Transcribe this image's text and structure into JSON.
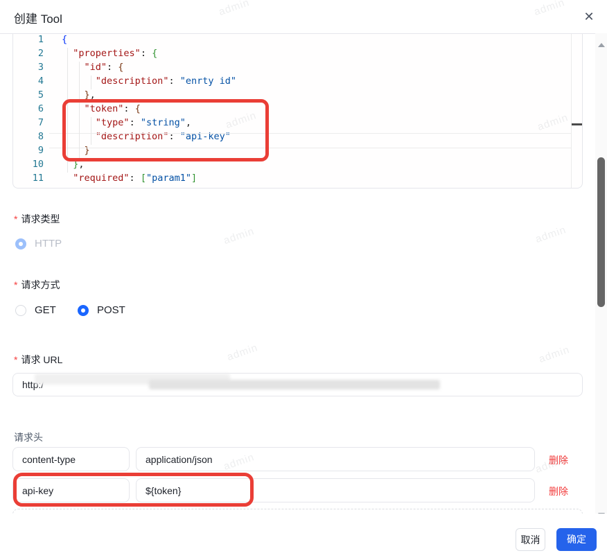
{
  "colors": {
    "accent_blue": "#1a66ff",
    "confirm_bg": "#2563eb",
    "danger_red": "#f23c3c",
    "annotation_red": "#ea3e36",
    "editor_key": "#a31515",
    "editor_string": "#0451a5",
    "line_number": "#237893"
  },
  "header": {
    "title": "创建 Tool",
    "close_icon": "✕"
  },
  "watermark": {
    "text": "admin"
  },
  "editor": {
    "lines": [
      {
        "num": "1",
        "tokens": [
          {
            "text": "{",
            "type": "b1"
          }
        ]
      },
      {
        "num": "2",
        "tokens": [
          {
            "text": "  ",
            "type": "pl"
          },
          {
            "text": "\"properties\"",
            "type": "key"
          },
          {
            "text": ": ",
            "type": "pl"
          },
          {
            "text": "{",
            "type": "b2"
          }
        ]
      },
      {
        "num": "3",
        "tokens": [
          {
            "text": "    ",
            "type": "pl"
          },
          {
            "text": "\"id\"",
            "type": "key"
          },
          {
            "text": ": ",
            "type": "pl"
          },
          {
            "text": "{",
            "type": "b3"
          }
        ]
      },
      {
        "num": "4",
        "tokens": [
          {
            "text": "      ",
            "type": "pl"
          },
          {
            "text": "\"description\"",
            "type": "key"
          },
          {
            "text": ": ",
            "type": "pl"
          },
          {
            "text": "\"enrty id\"",
            "type": "str"
          }
        ]
      },
      {
        "num": "5",
        "tokens": [
          {
            "text": "    ",
            "type": "pl"
          },
          {
            "text": "}",
            "type": "b3"
          },
          {
            "text": ",",
            "type": "pl"
          }
        ]
      },
      {
        "num": "6",
        "tokens": [
          {
            "text": "    ",
            "type": "pl"
          },
          {
            "text": "\"token\"",
            "type": "key"
          },
          {
            "text": ": ",
            "type": "pl"
          },
          {
            "text": "{",
            "type": "b3"
          }
        ]
      },
      {
        "num": "7",
        "tokens": [
          {
            "text": "      ",
            "type": "pl"
          },
          {
            "text": "\"type\"",
            "type": "key"
          },
          {
            "text": ": ",
            "type": "pl"
          },
          {
            "text": "\"string\"",
            "type": "str"
          },
          {
            "text": ",",
            "type": "pl"
          }
        ]
      },
      {
        "num": "8",
        "tokens": [
          {
            "text": "      ",
            "type": "pl"
          },
          {
            "text": "\"description\"",
            "type": "key"
          },
          {
            "text": ": ",
            "type": "pl"
          },
          {
            "text": "\"api-key\"",
            "type": "str"
          }
        ]
      },
      {
        "num": "9",
        "tokens": [
          {
            "text": "    ",
            "type": "pl"
          },
          {
            "text": "}",
            "type": "b3"
          }
        ]
      },
      {
        "num": "10",
        "tokens": [
          {
            "text": "  ",
            "type": "pl"
          },
          {
            "text": "}",
            "type": "b2"
          },
          {
            "text": ",",
            "type": "pl"
          }
        ]
      },
      {
        "num": "11",
        "tokens": [
          {
            "text": "  ",
            "type": "pl"
          },
          {
            "text": "\"required\"",
            "type": "key"
          },
          {
            "text": ": ",
            "type": "pl"
          },
          {
            "text": "[",
            "type": "b2"
          },
          {
            "text": "\"param1\"",
            "type": "str"
          },
          {
            "text": "]",
            "type": "b2"
          }
        ]
      }
    ]
  },
  "form": {
    "request_type": {
      "label": "请求类型",
      "asterisk": "*",
      "option_http": "HTTP"
    },
    "request_method": {
      "label": "请求方式",
      "asterisk": "*",
      "option_get": "GET",
      "option_post": "POST"
    },
    "request_url": {
      "label": "请求 URL",
      "asterisk": "*",
      "value": "http:/"
    },
    "headers": {
      "label": "请求头",
      "rows": [
        {
          "key": "content-type",
          "value": "application/json",
          "delete_label": "删除"
        },
        {
          "key": "api-key",
          "value": "${token}",
          "delete_label": "删除"
        }
      ]
    }
  },
  "footer": {
    "cancel_label": "取消",
    "confirm_label": "确定"
  }
}
